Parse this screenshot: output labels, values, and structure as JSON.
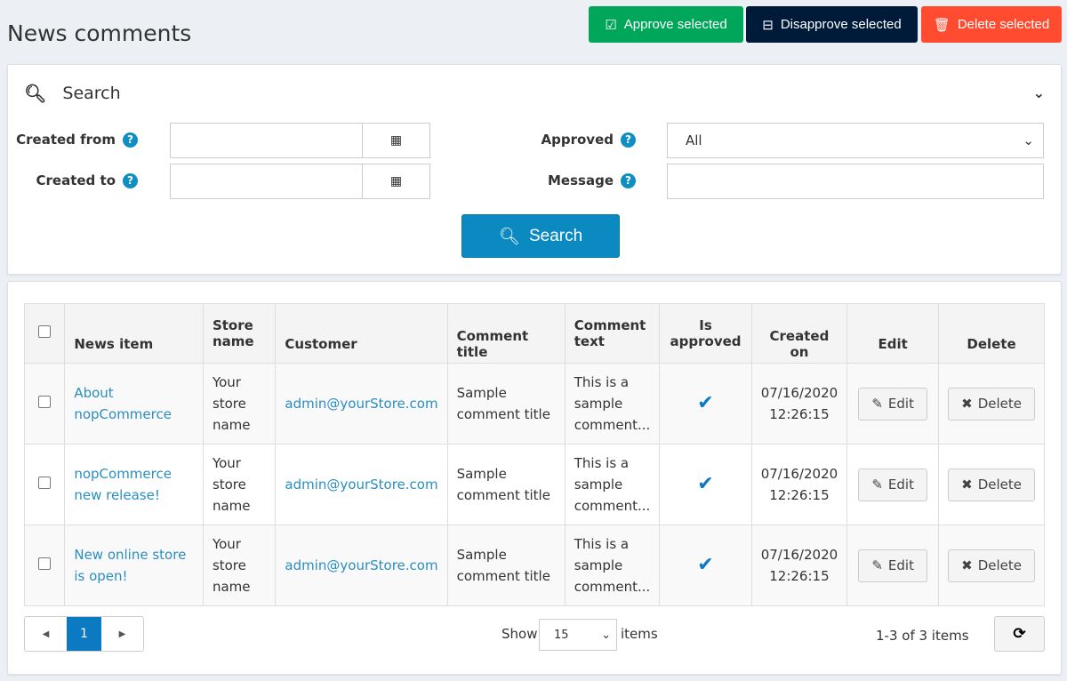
{
  "page_title": "News comments",
  "toolbar": {
    "approve": "Approve selected",
    "disapprove": "Disapprove selected",
    "delete": "Delete selected"
  },
  "colors": {
    "approve": "#00a65a",
    "disapprove": "#001a3a",
    "delete": "#ff4c30",
    "primary": "#0b8ac2"
  },
  "search": {
    "title": "Search",
    "created_from": "Created from",
    "created_to": "Created to",
    "approved": "Approved",
    "approved_value": "All",
    "message": "Message",
    "button": "Search"
  },
  "table": {
    "headers": [
      "News item",
      "Store name",
      "Customer",
      "Comment title",
      "Comment text",
      "Is approved",
      "Created on",
      "Edit",
      "Delete"
    ],
    "rows": [
      {
        "news": "About nopCommerce",
        "store": "Your store name",
        "customer": "admin@yourStore.com",
        "title": "Sample comment title",
        "text": "This is a sample comment...",
        "approved": true,
        "created": "07/16/2020 12:26:15",
        "edit": "Edit",
        "delete": "Delete"
      },
      {
        "news": "nopCommerce new release!",
        "store": "Your store name",
        "customer": "admin@yourStore.com",
        "title": "Sample comment title",
        "text": "This is a sample comment...",
        "approved": true,
        "created": "07/16/2020 12:26:15",
        "edit": "Edit",
        "delete": "Delete"
      },
      {
        "news": "New online store is open!",
        "store": "Your store name",
        "customer": "admin@yourStore.com",
        "title": "Sample comment title",
        "text": "This is a sample comment...",
        "approved": true,
        "created": "07/16/2020 12:26:15",
        "edit": "Edit",
        "delete": "Delete"
      }
    ]
  },
  "pager": {
    "page": "1",
    "show": "Show",
    "page_size": "15",
    "items": "items",
    "summary": "1-3 of 3 items"
  }
}
